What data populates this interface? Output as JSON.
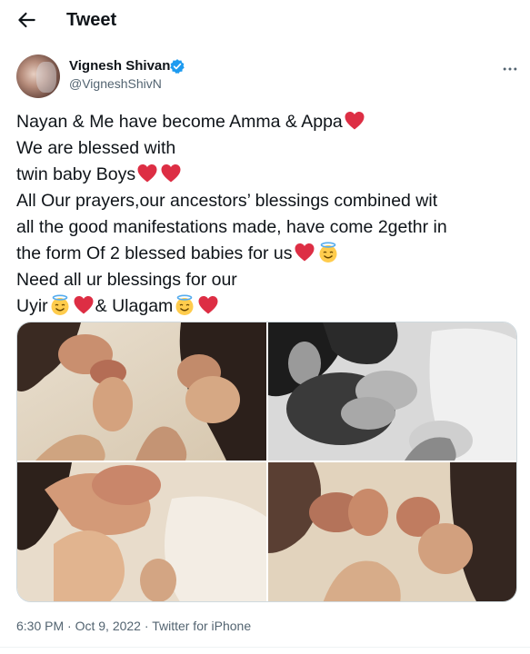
{
  "header": {
    "title": "Tweet",
    "back_icon": "arrow-left-icon"
  },
  "author": {
    "display_name": "Vignesh Shivan",
    "handle": "@VigneshShivN",
    "verified": true,
    "verified_color": "#1d9bf0",
    "more_icon": "more-horizontal-icon"
  },
  "tweet": {
    "line1": "Nayan & Me have become Amma & Appa",
    "line2": "We are blessed with",
    "line3": "twin baby Boys",
    "line4": "All Our prayers,our ancestors’ blessings combined wit",
    "line5": "all the good manifestations made, have come 2gethr in",
    "line6": "the form Of 2 blessed babies for us",
    "line7": "Need all ur blessings for our",
    "line8a": "Uyir",
    "line8b": "& Ulagam",
    "emoji": {
      "heart": "red-heart-emoji",
      "angel": "smiling-face-with-halo-emoji"
    }
  },
  "media": {
    "count": 4,
    "photos": [
      "photo-1",
      "photo-2",
      "photo-3",
      "photo-4"
    ]
  },
  "meta": {
    "time": "6:30 PM",
    "sep1": " · ",
    "date": "Oct 9, 2022",
    "sep2": " · ",
    "source": "Twitter for iPhone"
  }
}
